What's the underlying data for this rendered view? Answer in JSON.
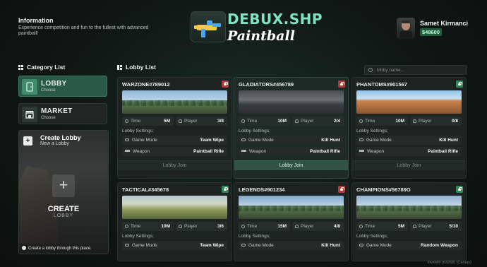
{
  "header": {
    "info_title": "Information",
    "info_text": "Experience competition and fun to the fullest with advanced paintball!",
    "logo_title": "DEBUX.SHP",
    "logo_subtitle": "Paintball",
    "user_name": "Samet Kirmanci",
    "user_money": "$48600"
  },
  "category": {
    "heading": "Category List",
    "items": [
      {
        "title": "LOBBY",
        "sub": "Choose",
        "icon": "lobby-door-icon"
      },
      {
        "title": "MARKET",
        "sub": "Choose",
        "icon": "market-store-icon"
      }
    ],
    "create": {
      "title": "Create Lobby",
      "sub": "New a Lobby",
      "big": "CREATE",
      "big2": "LOBBY",
      "footer": "Create a lobby through this place."
    }
  },
  "lobby": {
    "heading": "Lobby List",
    "search_placeholder": "lobby name...",
    "labels": {
      "time": "Time",
      "player": "Player",
      "settings": "Lobby Settings;",
      "game_mode": "Game Mode",
      "weapon": "Weapon",
      "join": "Lobby Join"
    },
    "cards": [
      {
        "name": "WARZONE#789012",
        "lock": "red",
        "time": "5M",
        "players": "3/8",
        "mode": "Team Wipe",
        "weapon": "Paintball Rifle"
      },
      {
        "name": "GLADIATORS#456789",
        "lock": "red",
        "time": "10M",
        "players": "2/4",
        "mode": "Kill Hunt",
        "weapon": "Paintball Rifle"
      },
      {
        "name": "PHANTOMS#901567",
        "lock": "green",
        "time": "10M",
        "players": "0/8",
        "mode": "Kill Hunt",
        "weapon": "Paintball Rifle"
      },
      {
        "name": "TACTICAL#345678",
        "lock": "green",
        "time": "10M",
        "players": "3/6",
        "mode": "Team Wipe"
      },
      {
        "name": "LEGENDS#901234",
        "lock": "red",
        "time": "15M",
        "players": "4/8",
        "mode": "Kill Hunt"
      },
      {
        "name": "CHAMPIONS#56789O",
        "lock": "green",
        "time": "5M",
        "players": "5/10",
        "mode": "Random Weapon"
      }
    ]
  },
  "footer": "FiveM® (b3258) (Canary)",
  "colors": {
    "accent": "#2f5446",
    "lock_red": "#b33a3a",
    "lock_green": "#2f8a56"
  }
}
